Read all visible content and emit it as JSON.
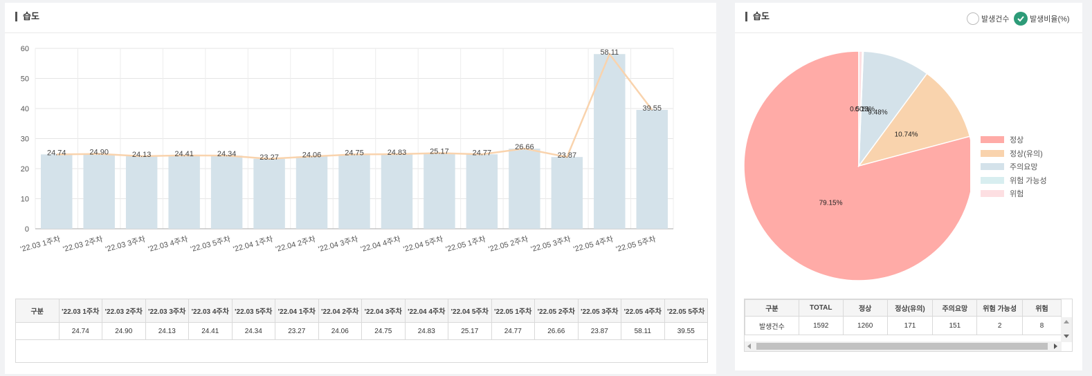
{
  "left": {
    "title": "습도",
    "table": {
      "header_label": "구분",
      "row_label": ""
    }
  },
  "right": {
    "title": "습도",
    "toggle": {
      "count_label": "발생건수",
      "ratio_label": "발생비율(%)",
      "selected": "ratio"
    },
    "legend": [
      {
        "label": "정상",
        "color": "#ffaba7"
      },
      {
        "label": "정상(유의)",
        "color": "#f9d3ad"
      },
      {
        "label": "주의요망",
        "color": "#d4e2ea"
      },
      {
        "label": "위험 가능성",
        "color": "#d8eef0"
      },
      {
        "label": "위험",
        "color": "#fddfe2"
      }
    ],
    "table": {
      "headers": [
        "구분",
        "TOTAL",
        "정상",
        "정상(유의)",
        "주의요망",
        "위험 가능성",
        "위험"
      ],
      "rows": [
        [
          "발생건수",
          "1592",
          "1260",
          "171",
          "151",
          "2",
          "8"
        ]
      ]
    }
  },
  "chart_data": [
    {
      "type": "bar",
      "categories": [
        "'22.03 1주차",
        "'22.03 2주차",
        "'22.03 3주차",
        "'22.03 4주차",
        "'22.03 5주차",
        "'22.04 1주차",
        "'22.04 2주차",
        "'22.04 3주차",
        "'22.04 4주차",
        "'22.04 5주차",
        "'22.05 1주차",
        "'22.05 2주차",
        "'22.05 3주차",
        "'22.05 4주차",
        "'22.05 5주차"
      ],
      "series": [
        {
          "type": "bar",
          "values": [
            24.74,
            24.9,
            24.13,
            24.41,
            24.34,
            23.27,
            24.06,
            24.75,
            24.83,
            25.17,
            24.77,
            26.66,
            23.87,
            58.11,
            39.55
          ],
          "color": "#d4e2ea"
        },
        {
          "type": "line",
          "values": [
            24.74,
            24.9,
            24.13,
            24.41,
            24.34,
            23.27,
            24.06,
            24.75,
            24.83,
            25.17,
            24.77,
            26.66,
            23.87,
            58.11,
            39.55
          ],
          "color": "#f9d3ad"
        }
      ],
      "value_labels": [
        "24.74",
        "24.90",
        "24.13",
        "24.41",
        "24.34",
        "23.27",
        "24.06",
        "24.75",
        "24.83",
        "25.17",
        "24.77",
        "26.66",
        "23.87",
        "58.11",
        "39.55"
      ],
      "ylim": [
        0,
        60
      ],
      "yticks": [
        0,
        10,
        20,
        30,
        40,
        50,
        60
      ],
      "grid": true
    },
    {
      "type": "pie",
      "categories": [
        "정상",
        "정상(유의)",
        "주의요망",
        "위험 가능성",
        "위험"
      ],
      "values": [
        79.15,
        10.74,
        9.48,
        0.13,
        0.5
      ],
      "slice_labels": [
        "79.15%",
        "10.74%",
        "9.48%",
        "0.13%",
        "0.50%"
      ],
      "colors": [
        "#ffaba7",
        "#f9d3ad",
        "#d4e2ea",
        "#d8eef0",
        "#fddfe2"
      ],
      "legend": "right"
    }
  ]
}
